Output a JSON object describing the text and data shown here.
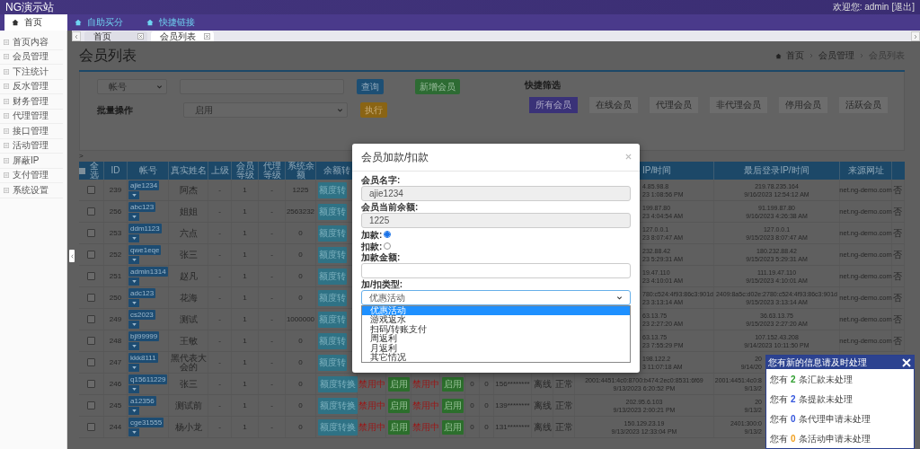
{
  "site": {
    "title": "NG演示站",
    "welcome": "欢迎您: admin",
    "logout": "[退出]"
  },
  "nav": [
    {
      "label": "首页",
      "selected": true
    },
    {
      "label": "自助买分",
      "selected": false
    },
    {
      "label": "快捷链接",
      "selected": false
    }
  ],
  "sidebar": {
    "items": [
      "首页内容",
      "会员管理",
      "下注统计",
      "反水管理",
      "财务管理",
      "代理管理",
      "接口管理",
      "活动管理",
      "屏蔽IP",
      "支付管理",
      "系统设置"
    ]
  },
  "tabs": [
    {
      "label": "首页",
      "selected": false
    },
    {
      "label": "会员列表",
      "selected": true
    }
  ],
  "page": {
    "title": "会员列表",
    "breadcrumb": [
      "首页",
      "会员管理",
      "会员列表"
    ]
  },
  "filter": {
    "field_select": "帐号",
    "query_button": "查询",
    "add_button": "新增会员",
    "batch_label": "批量操作",
    "batch_select": "启用",
    "execute_button": "执行",
    "quick_label": "快捷筛选",
    "quick": [
      {
        "label": "所有会员",
        "selected": true
      },
      {
        "label": "在线会员",
        "selected": false
      },
      {
        "label": "代理会员",
        "selected": false
      },
      {
        "label": "非代理会员",
        "selected": false
      },
      {
        "label": "停用会员",
        "selected": false
      },
      {
        "label": "活跃会员",
        "selected": false
      }
    ]
  },
  "marker": ">",
  "table": {
    "select_all_checked": false,
    "columns": [
      "全选",
      "ID",
      "帐号",
      "真实姓名",
      "上级",
      "会员等级",
      "代理等级",
      "系统余额",
      "余额转",
      "IP/时间",
      "最后登录IP/时间",
      "来源网址"
    ],
    "rows": [
      {
        "kind": "dialog",
        "checked": false,
        "id": "239",
        "account": "ajie1234",
        "name": "阿杰",
        "parent": "-",
        "level": "1",
        "agent_level": "-",
        "balance": "1225",
        "convert": "额度转",
        "reg_ip": "4.85.98.8",
        "reg_time": "23 1:08:56 PM",
        "last_ip": "219.78.235.164",
        "last_time": "9/16/2023 12:54:12 AM",
        "source": "net.ng-demo.com",
        "flag": "否"
      },
      {
        "kind": "dialog",
        "checked": false,
        "id": "256",
        "account": "abc123",
        "name": "姐姐",
        "parent": "-",
        "level": "1",
        "agent_level": "-",
        "balance": "2563232",
        "convert": "额度转",
        "reg_ip": "199.87.80",
        "reg_time": "23 4:04:54 AM",
        "last_ip": "91.199.87.80",
        "last_time": "9/16/2023 4:26:38 AM",
        "source": "net.ng-demo.com",
        "flag": "否"
      },
      {
        "kind": "dialog",
        "checked": false,
        "id": "253",
        "account": "ddm1123",
        "name": "六点",
        "parent": "-",
        "level": "1",
        "agent_level": "-",
        "balance": "0",
        "convert": "额度转",
        "reg_ip": "127.0.0.1",
        "reg_time": "23 8:07:47 AM",
        "last_ip": "127.0.0.1",
        "last_time": "9/15/2023 8:07:47 AM",
        "source": "net.ng-demo.com",
        "flag": "否"
      },
      {
        "kind": "dialog",
        "checked": false,
        "id": "252",
        "account": "qwe1eqe",
        "name": "张三",
        "parent": "-",
        "level": "1",
        "agent_level": "-",
        "balance": "0",
        "convert": "额度转",
        "reg_ip": "232.88.42",
        "reg_time": "23 5:29:31 AM",
        "last_ip": "180.232.88.42",
        "last_time": "9/15/2023 5:29:31 AM",
        "source": "net.ng-demo.com",
        "flag": "否"
      },
      {
        "kind": "dialog",
        "checked": false,
        "id": "251",
        "account": "admin1314",
        "name": "赵凡",
        "parent": "-",
        "level": "1",
        "agent_level": "-",
        "balance": "0",
        "convert": "额度转",
        "reg_ip": "19.47.110",
        "reg_time": "23 4:10:01 AM",
        "last_ip": "111.19.47.110",
        "last_time": "9/15/2023 4:10:01 AM",
        "source": "net.ng-demo.com",
        "flag": "否"
      },
      {
        "kind": "dialog",
        "checked": false,
        "id": "250",
        "account": "adc123",
        "name": "花海",
        "parent": "-",
        "level": "1",
        "agent_level": "-",
        "balance": "0",
        "convert": "额度转",
        "reg_ip": "780:c524:4f93:86c3:901d",
        "reg_time": "23 3:13:14 AM",
        "last_ip": "2409:8a5c:d02e:2780:c524:4f93:86c3:901d",
        "last_time": "9/15/2023 3:13:14 AM",
        "source": "net.ng-demo.com",
        "flag": "否"
      },
      {
        "kind": "dialog",
        "checked": false,
        "id": "249",
        "account": "cs2023",
        "name": "测试",
        "parent": "-",
        "level": "1",
        "agent_level": "-",
        "balance": "1000000",
        "convert": "额度转",
        "reg_ip": "63.13.75",
        "reg_time": "23 2:27:20 AM",
        "last_ip": "36.63.13.75",
        "last_time": "9/15/2023 2:27:20 AM",
        "source": "net.ng-demo.com",
        "flag": "否"
      },
      {
        "kind": "dialog",
        "checked": false,
        "id": "248",
        "account": "bjl99999",
        "name": "王敏",
        "parent": "-",
        "level": "1",
        "agent_level": "-",
        "balance": "0",
        "convert": "额度转",
        "reg_ip": "63.13.75",
        "reg_time": "23 7:55:29 PM",
        "last_ip": "107.152.43.208",
        "last_time": "9/14/2023 10:11:50 PM",
        "source": "net.ng-demo.com",
        "flag": "否"
      },
      {
        "kind": "both",
        "checked": false,
        "id": "247",
        "account": "kkk8111",
        "name": "黑代表大会的",
        "parent": "-",
        "level": "1",
        "agent_level": "-",
        "balance": "0",
        "convert": "额度转",
        "reg_ip": "198.122.2",
        "reg_time": "3 11:07:18 AM",
        "last_ip": "20",
        "last_time": "9/14/20"
      },
      {
        "kind": "notice",
        "checked": false,
        "id": "246",
        "account": "q15611229",
        "name": "张三",
        "parent": "-",
        "level": "1",
        "agent_level": "-",
        "balance": "0",
        "convert": "额度转换",
        "states": [
          {
            "kind": "label",
            "text": "禁用中"
          },
          {
            "kind": "button",
            "text": "启用"
          },
          {
            "kind": "label",
            "text": "禁用中"
          },
          {
            "kind": "button",
            "text": "启用"
          }
        ],
        "count_1": "0",
        "count_2": "0",
        "phone": "156********",
        "online": "离线",
        "status": "正常",
        "reg_ip": "2001:4451:4c0:8700:b474:2ec0:8531:6f69",
        "reg_time": "9/13/2023 6:20:52 PM",
        "last_ip": "2001:4451:4c0:8",
        "last_time": "9/13/2"
      },
      {
        "kind": "notice",
        "checked": false,
        "id": "245",
        "account": "a12356",
        "name": "测试前",
        "parent": "-",
        "level": "1",
        "agent_level": "-",
        "balance": "0",
        "convert": "额度转换",
        "states": [
          {
            "kind": "label",
            "text": "禁用中"
          },
          {
            "kind": "button",
            "text": "启用"
          },
          {
            "kind": "label",
            "text": "禁用中"
          },
          {
            "kind": "button",
            "text": "启用"
          }
        ],
        "count_1": "0",
        "count_2": "0",
        "phone": "139********",
        "online": "离线",
        "status": "正常",
        "reg_ip": "202.95.6.103",
        "reg_time": "9/13/2023 2:00:21 PM",
        "last_ip": "20",
        "last_time": "9/13/2"
      },
      {
        "kind": "notice",
        "checked": false,
        "id": "244",
        "account": "cge31555",
        "name": "杨小龙",
        "parent": "-",
        "level": "1",
        "agent_level": "-",
        "balance": "0",
        "convert": "额度转换",
        "states": [
          {
            "kind": "label",
            "text": "禁用中"
          },
          {
            "kind": "button",
            "text": "启用"
          },
          {
            "kind": "label",
            "text": "禁用中"
          },
          {
            "kind": "button",
            "text": "启用"
          }
        ],
        "count_1": "0",
        "count_2": "0",
        "phone": "131********",
        "online": "离线",
        "status": "正常",
        "reg_ip": "150.129.23.19",
        "reg_time": "9/13/2023 12:33:04 PM",
        "last_ip": "2401:300:0",
        "last_time": "9/13/2"
      }
    ]
  },
  "modal": {
    "title": "会员加款/扣款",
    "name_label": "会员名字:",
    "name_value": "ajie1234",
    "balance_label": "会员当前余额:",
    "balance_value": "1225",
    "radios": [
      {
        "label": "加款:",
        "selected": true
      },
      {
        "label": "扣款:",
        "selected": false
      }
    ],
    "amount_label": "加款金额:",
    "type_label": "加/扣类型:",
    "type_value": "优惠活动",
    "options": [
      {
        "label": "优惠活动",
        "selected": true
      },
      {
        "label": "游戏返水",
        "selected": false
      },
      {
        "label": "扫码/转账支付",
        "selected": false
      },
      {
        "label": "周返利",
        "selected": false
      },
      {
        "label": "月返利",
        "selected": false
      },
      {
        "label": "其它情况",
        "selected": false
      }
    ]
  },
  "notice": {
    "title": "您有新的信息请及时处理",
    "items": [
      {
        "before": "您有",
        "count": "2",
        "after": "条汇款未处理",
        "color": "#2e9e2e"
      },
      {
        "before": "您有",
        "count": "2",
        "after": "条提款未处理",
        "color": "#3355dd"
      },
      {
        "before": "您有",
        "count": "0",
        "after": "条代理申请未处理",
        "color": "#3355dd"
      },
      {
        "before": "您有",
        "count": "0",
        "after": "条活动申请未处理",
        "color": "#f0a020"
      }
    ]
  }
}
